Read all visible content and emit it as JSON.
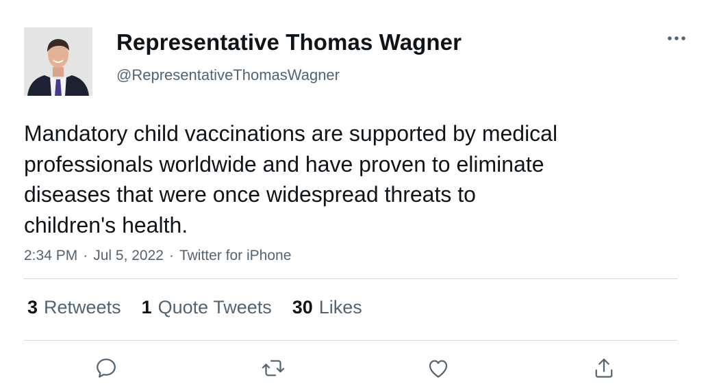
{
  "author": {
    "display_name": "Representative Thomas Wagner",
    "handle": "@RepresentativeThomasWagner"
  },
  "tweet": {
    "lines": [
      "Mandatory child vaccinations are supported by medical",
      "professionals worldwide and have proven to eliminate",
      "diseases that were once widespread threats to",
      "children's health."
    ],
    "time": "2:34 PM",
    "date": "Jul 5, 2022",
    "source": "Twitter for iPhone",
    "separator": "·"
  },
  "stats": {
    "retweets": {
      "count": "3",
      "label": "Retweets"
    },
    "quotes": {
      "count": "1",
      "label": "Quote Tweets"
    },
    "likes": {
      "count": "30",
      "label": "Likes"
    }
  },
  "icons": {
    "more": "more-horizontal-icon",
    "reply": "reply-icon",
    "retweet": "retweet-icon",
    "like": "heart-icon",
    "share": "share-icon"
  },
  "colors": {
    "text_primary": "#0f1419",
    "text_secondary": "#536471",
    "divider": "#cfd9de"
  }
}
